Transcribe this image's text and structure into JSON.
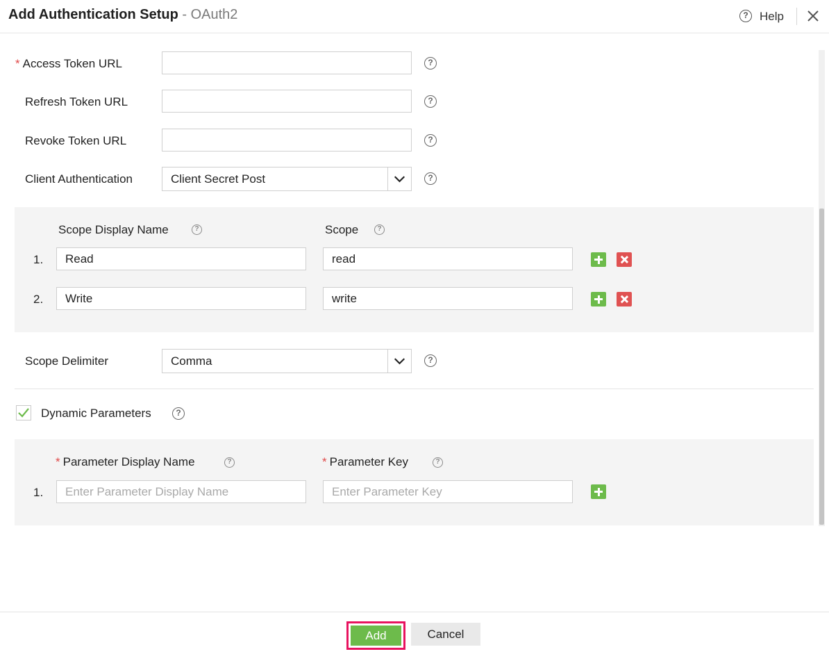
{
  "header": {
    "title": "Add Authentication Setup",
    "separator": " - ",
    "subtitle": "OAuth2",
    "help_label": "Help"
  },
  "icons": {
    "help": "question-circle-icon",
    "close": "close-icon",
    "add_row": "plus-icon",
    "remove_row": "x-icon",
    "checkbox": "checkmark-icon",
    "dropdown": "chevron-down-icon"
  },
  "form": {
    "access_token_url": {
      "label": "Access Token URL",
      "required": "*",
      "value": ""
    },
    "refresh_token_url": {
      "label": "Refresh Token URL",
      "value": ""
    },
    "revoke_token_url": {
      "label": "Revoke Token URL",
      "value": ""
    },
    "client_authentication": {
      "label": "Client Authentication",
      "value": "Client Secret Post"
    },
    "scopes": {
      "header_display_name": "Scope Display Name",
      "header_scope": "Scope",
      "rows": [
        {
          "num": "1.",
          "display_name": "Read",
          "scope": "read"
        },
        {
          "num": "2.",
          "display_name": "Write",
          "scope": "write"
        }
      ]
    },
    "scope_delimiter": {
      "label": "Scope Delimiter",
      "value": "Comma"
    },
    "dynamic_parameters": {
      "label": "Dynamic Parameters",
      "checked": true
    },
    "parameters": {
      "header_display_name": "Parameter Display Name",
      "header_key": "Parameter Key",
      "required": "*",
      "rows": [
        {
          "num": "1.",
          "display_name": "",
          "display_name_placeholder": "Enter Parameter Display Name",
          "key": "",
          "key_placeholder": "Enter Parameter Key"
        }
      ]
    }
  },
  "footer": {
    "add_label": "Add",
    "cancel_label": "Cancel"
  },
  "colors": {
    "accent_green": "#6dbb4b",
    "danger_red": "#e05252",
    "required_red": "#e04848",
    "highlight_pink": "#e8135f",
    "panel_bg": "#f4f4f4"
  }
}
